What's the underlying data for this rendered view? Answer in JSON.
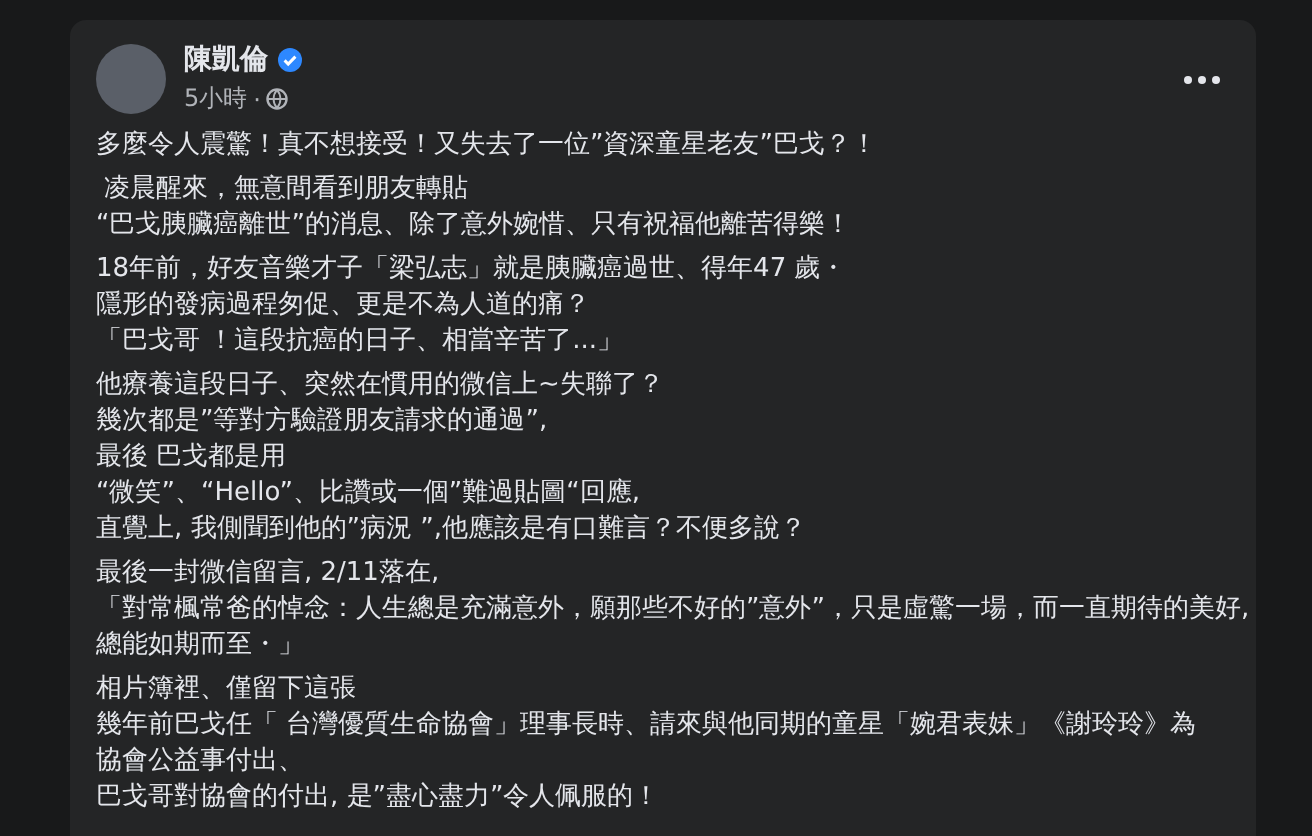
{
  "post": {
    "author": "陳凱倫",
    "verified": true,
    "time": "5小時",
    "separator": "·",
    "paragraphs": [
      {
        "lines": [
          "多麼令人震驚！真不想接受！又失去了一位”資深童星老友”巴戈？！"
        ]
      },
      {
        "lines": [
          " 凌晨醒來，無意間看到朋友轉貼",
          "“巴戈胰臟癌離世”的消息、除了意外婉惜、只有祝福他離苦得樂！"
        ]
      },
      {
        "lines": [
          "18年前，好友音樂才子「梁弘志」就是胰臟癌過世、得年47 歲・",
          "隱形的發病過程匆促、更是不為人道的痛？",
          "「巴戈哥 ！這段抗癌的日子、相當辛苦了...」"
        ]
      },
      {
        "lines": [
          "他療養這段日子、突然在慣用的微信上~失聯了？",
          "幾次都是”等對方驗證朋友請求的通過”,",
          "最後 巴戈都是用",
          "“微笑”、“Hello”、比讚或一個”難過貼圖“回應,",
          "直覺上, 我側聞到他的”病況 ”,他應該是有口難言？不便多說？"
        ]
      },
      {
        "lines": [
          "最後一封微信留言, 2/11落在,",
          "「對常楓常爸的悼念：人生總是充滿意外，願那些不好的”意外”，只是虛驚一場，而一直期待的美好, 總能如期而至・」"
        ]
      },
      {
        "lines": [
          "相片簿裡、僅留下這張",
          "幾年前巴戈任「 台灣優質生命協會」理事長時、請來與他同期的童星「婉君表妹」《謝玲玲》為",
          "協會公益事付出、",
          "巴戈哥對協會的付出, 是”盡心盡力”令人佩服的！"
        ]
      }
    ]
  }
}
